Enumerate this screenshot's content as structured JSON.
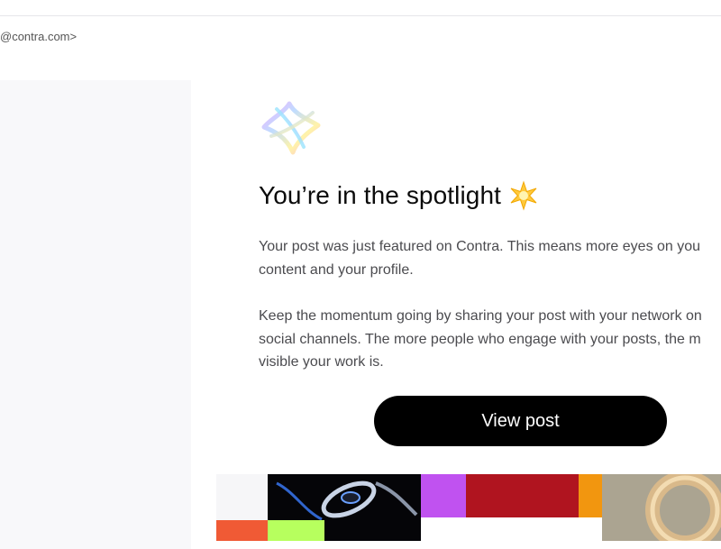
{
  "header": {
    "sender_fragment": "@contra.com>"
  },
  "email": {
    "headline": "You’re in the spotlight",
    "headline_emoji": "glowing-star-icon",
    "paragraph1_lines": [
      "Your post was just featured on Contra. This means more eyes on you",
      "content and your profile."
    ],
    "paragraph2_lines": [
      "Keep the momentum going by sharing your post with your network on",
      "social channels. The more people who engage with your posts, the m",
      "visible your work is."
    ],
    "cta_label": "View post"
  },
  "icons": {
    "logo": "contra-logo-icon",
    "star": "glowing-star-icon"
  },
  "colors": {
    "button_bg": "#000000",
    "button_text": "#ffffff",
    "body_text": "#4b4b4f",
    "headline": "#0b0b0b",
    "left_panel": "#f8f8fa"
  }
}
